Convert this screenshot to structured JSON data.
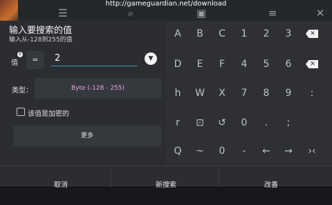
{
  "topbar": {
    "url": "http://gameguardian.net/download",
    "icons": [
      "app-thumbnail",
      "sliders-icon",
      "search-icon",
      "save-icon",
      "list-icon",
      "close-icon"
    ]
  },
  "dialog": {
    "title": "输入要搜索的值",
    "subtitle": "输入从-128到255的值",
    "value_label": "值",
    "operator": "=",
    "value": "2",
    "type_label": "类型：",
    "type_value": "Byte (-128 - 255)",
    "encrypted_label": "该值是加密的",
    "more_label": "更多"
  },
  "keyboard": {
    "rows": [
      [
        "A",
        "B",
        "C",
        "1",
        "2",
        "3",
        "⌫"
      ],
      [
        "D",
        "E",
        "F",
        "4",
        "5",
        "6",
        "⌫"
      ],
      [
        "h",
        "W",
        "X",
        "7",
        "8",
        "9",
        ":"
      ],
      [
        "r",
        "⊡",
        "↺",
        "0",
        ".",
        ";",
        ""
      ],
      [
        "Q",
        "~",
        "0",
        "-",
        "←",
        "→",
        "›‹"
      ]
    ]
  },
  "buttons": {
    "cancel": "取消",
    "new_search": "新搜索",
    "refine": "改善"
  }
}
